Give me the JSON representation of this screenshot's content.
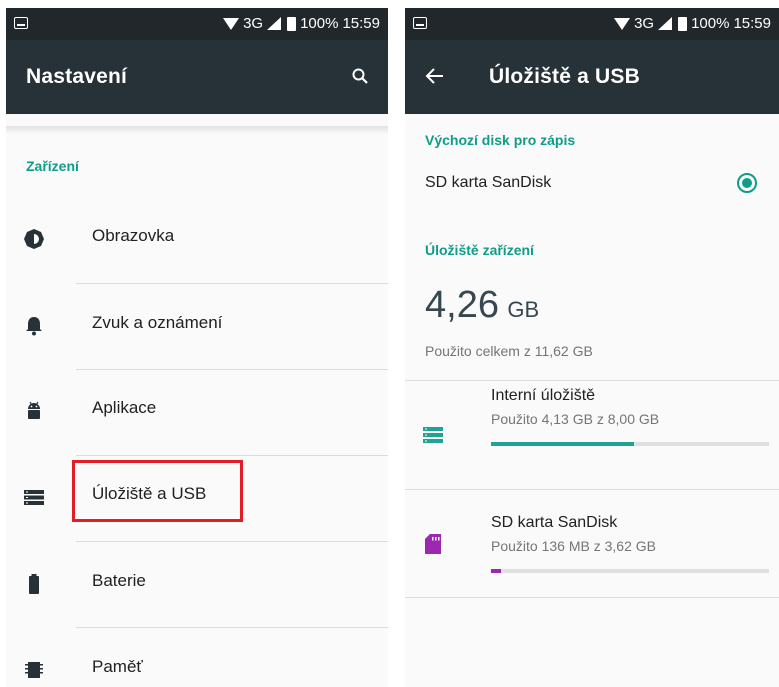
{
  "status_bar": {
    "network": "3G",
    "battery": "100%",
    "time": "15:59"
  },
  "left_screen": {
    "title": "Nastavení",
    "category": "Zařízení",
    "items": [
      {
        "label": "Obrazovka",
        "icon": "brightness-icon"
      },
      {
        "label": "Zvuk a oznámení",
        "icon": "bell-icon"
      },
      {
        "label": "Aplikace",
        "icon": "android-icon"
      },
      {
        "label": "Úložiště a USB",
        "icon": "storage-icon"
      },
      {
        "label": "Baterie",
        "icon": "battery-icon"
      },
      {
        "label": "Paměť",
        "icon": "memory-chip-icon"
      }
    ]
  },
  "right_screen": {
    "title": "Úložiště a USB",
    "default_disk_header": "Výchozí disk pro zápis",
    "default_disk_value": "SD karta SanDisk",
    "device_storage_header": "Úložiště zařízení",
    "total_used_value": "4,26",
    "total_used_unit": "GB",
    "total_used_caption": "Použito celkem z 11,62 GB",
    "volumes": [
      {
        "name": "Interní úložiště",
        "usage": "Použito 4,13 GB z 8,00 GB",
        "used_fraction": 0.516,
        "color": "#1fa392",
        "icon": "storage-icon"
      },
      {
        "name": "SD karta SanDisk",
        "usage": "Použito 136 MB z 3,62 GB",
        "used_fraction": 0.037,
        "color": "#9c27b0",
        "icon": "sd-card-icon"
      }
    ]
  },
  "colors": {
    "accent": "#0f9d8a",
    "appbar": "#263238",
    "highlight": "#e11d25"
  }
}
